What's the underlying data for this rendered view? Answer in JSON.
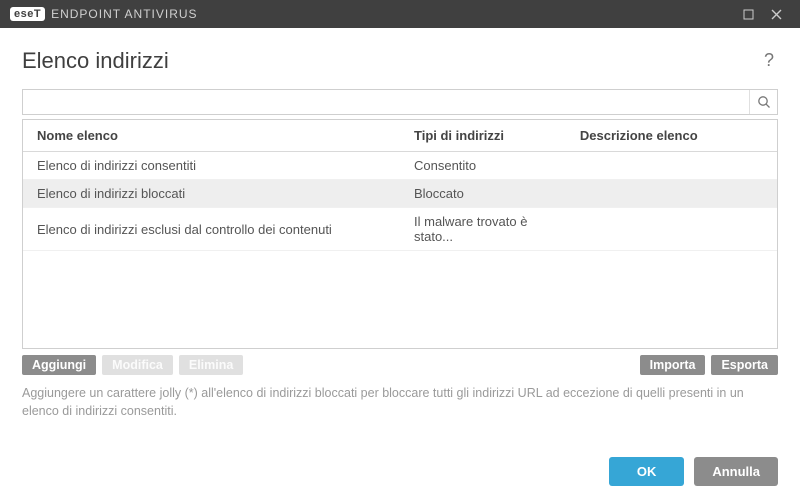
{
  "titlebar": {
    "logo_text": "eseT",
    "product_name": "ENDPOINT ANTIVIRUS"
  },
  "page": {
    "title": "Elenco indirizzi"
  },
  "search": {
    "value": "",
    "placeholder": ""
  },
  "table": {
    "headers": {
      "name": "Nome elenco",
      "type": "Tipi di indirizzi",
      "desc": "Descrizione elenco"
    },
    "rows": [
      {
        "name": "Elenco di indirizzi consentiti",
        "type": "Consentito",
        "desc": "",
        "selected": false
      },
      {
        "name": "Elenco di indirizzi bloccati",
        "type": "Bloccato",
        "desc": "",
        "selected": true
      },
      {
        "name": "Elenco di indirizzi esclusi dal controllo dei contenuti",
        "type": "Il malware trovato è stato...",
        "desc": "",
        "selected": false
      }
    ]
  },
  "actions": {
    "add": "Aggiungi",
    "edit": "Modifica",
    "delete": "Elimina",
    "import": "Importa",
    "export": "Esporta"
  },
  "hint": "Aggiungere un carattere jolly (*) all'elenco di indirizzi bloccati per bloccare tutti gli indirizzi URL ad eccezione di quelli presenti in un elenco di indirizzi consentiti.",
  "footer": {
    "ok": "OK",
    "cancel": "Annulla"
  }
}
